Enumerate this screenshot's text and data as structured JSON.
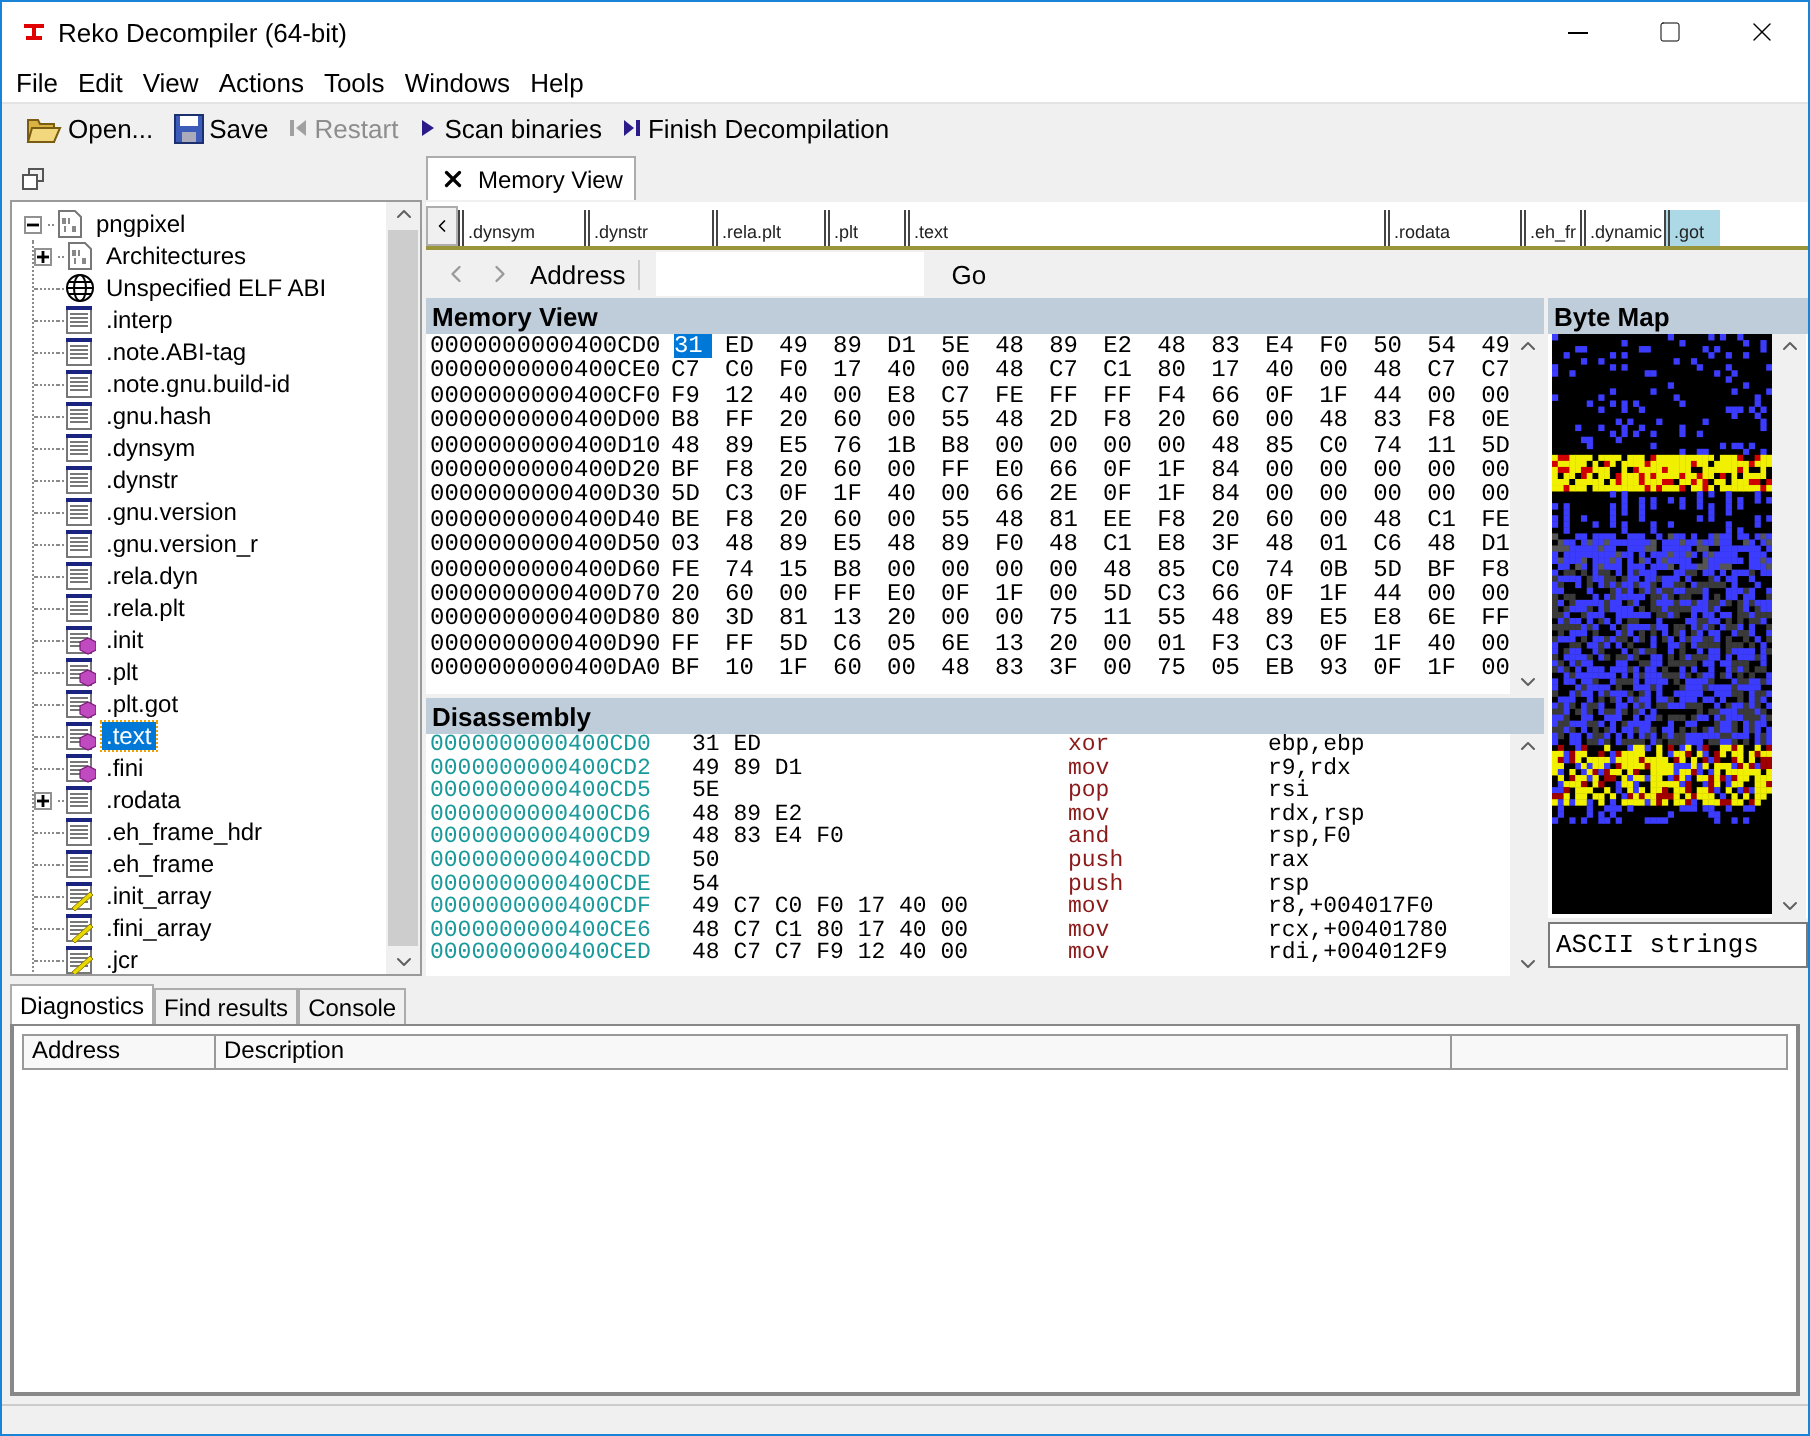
{
  "window": {
    "title": "Reko Decompiler (64-bit)"
  },
  "menu": [
    "File",
    "Edit",
    "View",
    "Actions",
    "Tools",
    "Windows",
    "Help"
  ],
  "toolbar": [
    {
      "label": "Open...",
      "kind": "open",
      "disabled": false
    },
    {
      "label": "Save",
      "kind": "save",
      "disabled": false
    },
    {
      "label": "Restart",
      "kind": "restart",
      "disabled": true
    },
    {
      "label": "Scan binaries",
      "kind": "play",
      "disabled": false
    },
    {
      "label": "Finish Decompilation",
      "kind": "finish",
      "disabled": false
    }
  ],
  "project_tree": [
    {
      "label": "pngpixel",
      "kind": "document",
      "expanded": true,
      "selected": false,
      "children": [
        {
          "label": "Architectures",
          "kind": "document",
          "expanded": false,
          "selected": false
        },
        {
          "label": "Unspecified ELF ABI",
          "kind": "globe",
          "selected": false
        },
        {
          "label": ".interp",
          "kind": "section",
          "selected": false
        },
        {
          "label": ".note.ABI-tag",
          "kind": "section",
          "selected": false
        },
        {
          "label": ".note.gnu.build-id",
          "kind": "section",
          "selected": false
        },
        {
          "label": ".gnu.hash",
          "kind": "section",
          "selected": false
        },
        {
          "label": ".dynsym",
          "kind": "section",
          "selected": false
        },
        {
          "label": ".dynstr",
          "kind": "section",
          "selected": false
        },
        {
          "label": ".gnu.version",
          "kind": "section",
          "selected": false
        },
        {
          "label": ".gnu.version_r",
          "kind": "section",
          "selected": false
        },
        {
          "label": ".rela.dyn",
          "kind": "section",
          "selected": false
        },
        {
          "label": ".rela.plt",
          "kind": "section",
          "selected": false
        },
        {
          "label": ".init",
          "kind": "code",
          "selected": false
        },
        {
          "label": ".plt",
          "kind": "code",
          "selected": false
        },
        {
          "label": ".plt.got",
          "kind": "code",
          "selected": false
        },
        {
          "label": ".text",
          "kind": "code",
          "selected": true
        },
        {
          "label": ".fini",
          "kind": "code",
          "selected": false
        },
        {
          "label": ".rodata",
          "kind": "section",
          "expanded": false,
          "selected": false
        },
        {
          "label": ".eh_frame_hdr",
          "kind": "section",
          "selected": false
        },
        {
          "label": ".eh_frame",
          "kind": "section",
          "selected": false
        },
        {
          "label": ".init_array",
          "kind": "data",
          "selected": false
        },
        {
          "label": ".fini_array",
          "kind": "data",
          "selected": false
        },
        {
          "label": ".jcr",
          "kind": "data",
          "selected": false
        }
      ]
    }
  ],
  "document_tabs": [
    {
      "label": "Memory View",
      "selected": true
    }
  ],
  "section_strip": [
    {
      "label": ".dynsym",
      "selected": false
    },
    {
      "label": ".dynstr",
      "selected": false
    },
    {
      "label": ".rela.plt",
      "selected": false
    },
    {
      "label": ".plt",
      "selected": false
    },
    {
      "label": ".text",
      "selected": false
    },
    {
      "label": ".rodata",
      "selected": false
    },
    {
      "label": ".eh_fr",
      "selected": false
    },
    {
      "label": ".dynamic",
      "selected": false
    },
    {
      "label": ".got",
      "selected": true
    }
  ],
  "address_bar": {
    "label": "Address",
    "button": "Go"
  },
  "memory_view": {
    "title": "Memory View",
    "rows": [
      {
        "address": "0000000000400CD0",
        "selected_byte": "31",
        "bytes": "ED 49 89 D1 5E 48 89 E2 48 83 E4 F0 50 54 49"
      },
      {
        "address": "0000000000400CE0",
        "bytes": "C7 C0 F0 17 40 00 48 C7 C1 80 17 40 00 48 C7 C7"
      },
      {
        "address": "0000000000400CF0",
        "bytes": "F9 12 40 00 E8 C7 FE FF FF F4 66 0F 1F 44 00 00"
      },
      {
        "address": "0000000000400D00",
        "bytes": "B8 FF 20 60 00 55 48 2D F8 20 60 00 48 83 F8 0E"
      },
      {
        "address": "0000000000400D10",
        "bytes": "48 89 E5 76 1B B8 00 00 00 00 48 85 C0 74 11 5D"
      },
      {
        "address": "0000000000400D20",
        "bytes": "BF F8 20 60 00 FF E0 66 0F 1F 84 00 00 00 00 00"
      },
      {
        "address": "0000000000400D30",
        "bytes": "5D C3 0F 1F 40 00 66 2E 0F 1F 84 00 00 00 00 00"
      },
      {
        "address": "0000000000400D40",
        "bytes": "BE F8 20 60 00 55 48 81 EE F8 20 60 00 48 C1 FE"
      },
      {
        "address": "0000000000400D50",
        "bytes": "03 48 89 E5 48 89 F0 48 C1 E8 3F 48 01 C6 48 D1"
      },
      {
        "address": "0000000000400D60",
        "bytes": "FE 74 15 B8 00 00 00 00 48 85 C0 74 0B 5D BF F8"
      },
      {
        "address": "0000000000400D70",
        "bytes": "20 60 00 FF E0 0F 1F 00 5D C3 66 0F 1F 44 00 00"
      },
      {
        "address": "0000000000400D80",
        "bytes": "80 3D 81 13 20 00 00 75 11 55 48 89 E5 E8 6E FF"
      },
      {
        "address": "0000000000400D90",
        "bytes": "FF FF 5D C6 05 6E 13 20 00 01 F3 C3 0F 1F 40 00"
      },
      {
        "address": "0000000000400DA0",
        "bytes": "BF 10 1F 60 00 48 83 3F 00 75 05 EB 93 0F 1F 00"
      }
    ]
  },
  "byte_map": {
    "title": "Byte Map",
    "encoding": "ASCII strings"
  },
  "disassembly": {
    "title": "Disassembly",
    "rows": [
      {
        "address": "0000000000400CD0",
        "bytes": "31 ED",
        "mnemonic": "xor",
        "operands": "ebp,ebp"
      },
      {
        "address": "0000000000400CD2",
        "bytes": "49 89 D1",
        "mnemonic": "mov",
        "operands": "r9,rdx"
      },
      {
        "address": "0000000000400CD5",
        "bytes": "5E",
        "mnemonic": "pop",
        "operands": "rsi"
      },
      {
        "address": "0000000000400CD6",
        "bytes": "48 89 E2",
        "mnemonic": "mov",
        "operands": "rdx,rsp"
      },
      {
        "address": "0000000000400CD9",
        "bytes": "48 83 E4 F0",
        "mnemonic": "and",
        "operands": "rsp,F0"
      },
      {
        "address": "0000000000400CDD",
        "bytes": "50",
        "mnemonic": "push",
        "operands": "rax"
      },
      {
        "address": "0000000000400CDE",
        "bytes": "54",
        "mnemonic": "push",
        "operands": "rsp"
      },
      {
        "address": "0000000000400CDF",
        "bytes": "49 C7 C0 F0 17 40 00",
        "mnemonic": "mov",
        "operands": "r8,+004017F0"
      },
      {
        "address": "0000000000400CE6",
        "bytes": "48 C7 C1 80 17 40 00",
        "mnemonic": "mov",
        "operands": "rcx,+00401780"
      },
      {
        "address": "0000000000400CED",
        "bytes": "48 C7 C7 F9 12 40 00",
        "mnemonic": "mov",
        "operands": "rdi,+004012F9"
      }
    ]
  },
  "bottom_tabs": [
    {
      "label": "Diagnostics",
      "selected": true
    },
    {
      "label": "Find results",
      "selected": false
    },
    {
      "label": "Console",
      "selected": false
    }
  ],
  "diagnostics_table": {
    "columns": [
      "Address",
      "Description"
    ]
  }
}
